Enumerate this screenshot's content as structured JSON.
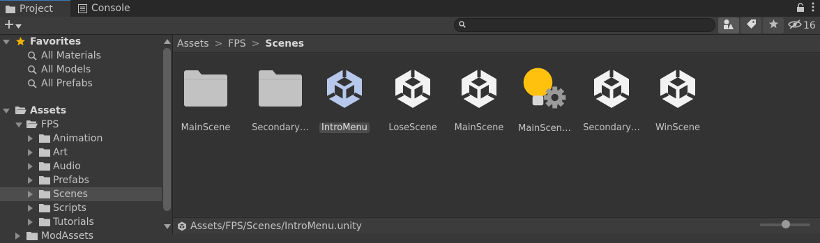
{
  "tabs": {
    "project": "Project",
    "console": "Console"
  },
  "toolbar": {
    "search_value": "",
    "hidden_count": "16"
  },
  "tree": {
    "favorites_label": "Favorites",
    "favorites": [
      "All Materials",
      "All Models",
      "All Prefabs"
    ],
    "assets_label": "Assets",
    "fps_label": "FPS",
    "fps_children": [
      "Animation",
      "Art",
      "Audio",
      "Prefabs",
      "Scenes",
      "Scripts",
      "Tutorials"
    ],
    "next_root": "ModAssets",
    "selected": "Scenes"
  },
  "breadcrumb": [
    "Assets",
    "FPS",
    "Scenes"
  ],
  "assets": [
    {
      "label": "MainScene",
      "icon": "folder-icon"
    },
    {
      "label": "Secondary…",
      "icon": "folder-icon"
    },
    {
      "label": "IntroMenu",
      "icon": "unity-scene-icon",
      "selected": true
    },
    {
      "label": "LoseScene",
      "icon": "unity-scene-icon"
    },
    {
      "label": "MainScene",
      "icon": "unity-scene-icon"
    },
    {
      "label": "MainScen…",
      "icon": "lighting-settings-icon"
    },
    {
      "label": "Secondary…",
      "icon": "unity-scene-icon"
    },
    {
      "label": "WinScene",
      "icon": "unity-scene-icon"
    }
  ],
  "status": {
    "path": "Assets/FPS/Scenes/IntroMenu.unity"
  },
  "zoom_slider": {
    "value": 0.52
  },
  "colors": {
    "selection": "#4d4d4d",
    "scene_selected": "#b7c8ec",
    "favorites_star": "#f0b400",
    "lightbulb": "#ffc10d"
  }
}
